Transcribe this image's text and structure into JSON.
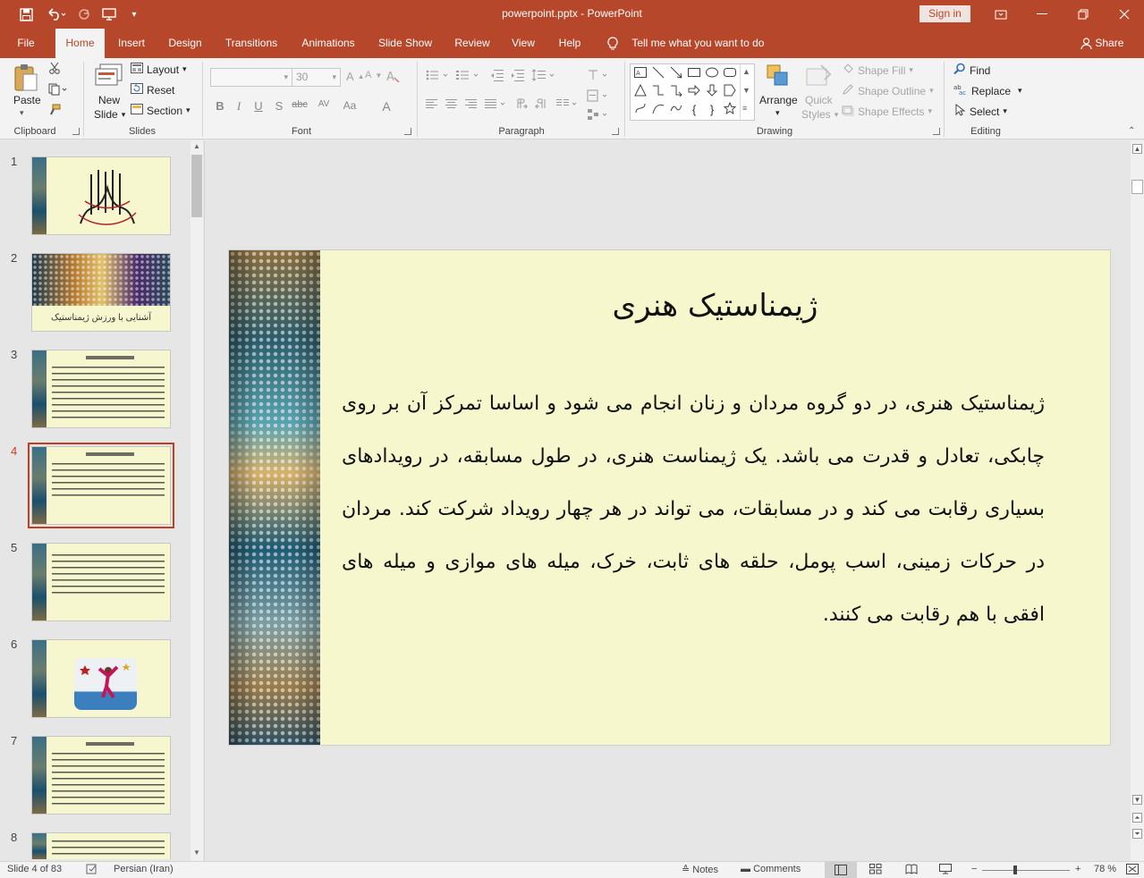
{
  "app": {
    "title": "powerpoint.pptx  -  PowerPoint",
    "signin": "Sign in",
    "qat": [
      "save-icon",
      "undo-icon",
      "redo-icon",
      "start-from-beginning-icon",
      "customize-icon"
    ]
  },
  "tabs": [
    "File",
    "Home",
    "Insert",
    "Design",
    "Transitions",
    "Animations",
    "Slide Show",
    "Review",
    "View",
    "Help"
  ],
  "active_tab": "Home",
  "tellme": "Tell me what you want to do",
  "share": "Share",
  "ribbon": {
    "clipboard": {
      "label": "Clipboard",
      "paste": "Paste"
    },
    "slides": {
      "label": "Slides",
      "new_slide_1": "New",
      "new_slide_2": "Slide",
      "layout": "Layout",
      "reset": "Reset",
      "section": "Section"
    },
    "font": {
      "label": "Font",
      "size": "30",
      "bold": "B",
      "italic": "I",
      "underline": "U",
      "shadow": "S",
      "strike": "abc",
      "spacing": "AV",
      "case": "Aa",
      "color": "A"
    },
    "paragraph": {
      "label": "Paragraph"
    },
    "drawing": {
      "label": "Drawing",
      "arrange": "Arrange",
      "quick_styles_1": "Quick",
      "quick_styles_2": "Styles",
      "shape_fill": "Shape Fill",
      "shape_outline": "Shape Outline",
      "shape_effects": "Shape Effects"
    },
    "editing": {
      "label": "Editing",
      "find": "Find",
      "replace": "Replace",
      "select": "Select"
    }
  },
  "thumbnails": [
    {
      "num": "1",
      "kind": "calligraphy"
    },
    {
      "num": "2",
      "kind": "banner",
      "caption": "آشنایی با ورزش ژیمناستیک"
    },
    {
      "num": "3",
      "kind": "text"
    },
    {
      "num": "4",
      "kind": "text",
      "active": true
    },
    {
      "num": "5",
      "kind": "text"
    },
    {
      "num": "6",
      "kind": "image"
    },
    {
      "num": "7",
      "kind": "text"
    },
    {
      "num": "8",
      "kind": "text"
    }
  ],
  "slide": {
    "title": "ژیمناستیک هنری",
    "body": "ژیمناستیک هنری، در دو گروه مردان و زنان انجام می شود و اساسا تمرکز آن بر روی چابکی، تعادل و قدرت می باشد. یک ژیمناست هنری، در طول مسابقه، در رویدادهای بسیاری رقابت می کند و در مسابقات، می تواند در هر چهار رویداد شرکت کند. مردان در حرکات زمینی، اسب پومل، حلقه های ثابت، خرک، میله های موازی و میله های افقی با هم رقابت می کنند."
  },
  "status": {
    "slide_of": "Slide 4 of 83",
    "language": "Persian (Iran)",
    "notes": "Notes",
    "comments": "Comments",
    "zoom": "78 %"
  }
}
